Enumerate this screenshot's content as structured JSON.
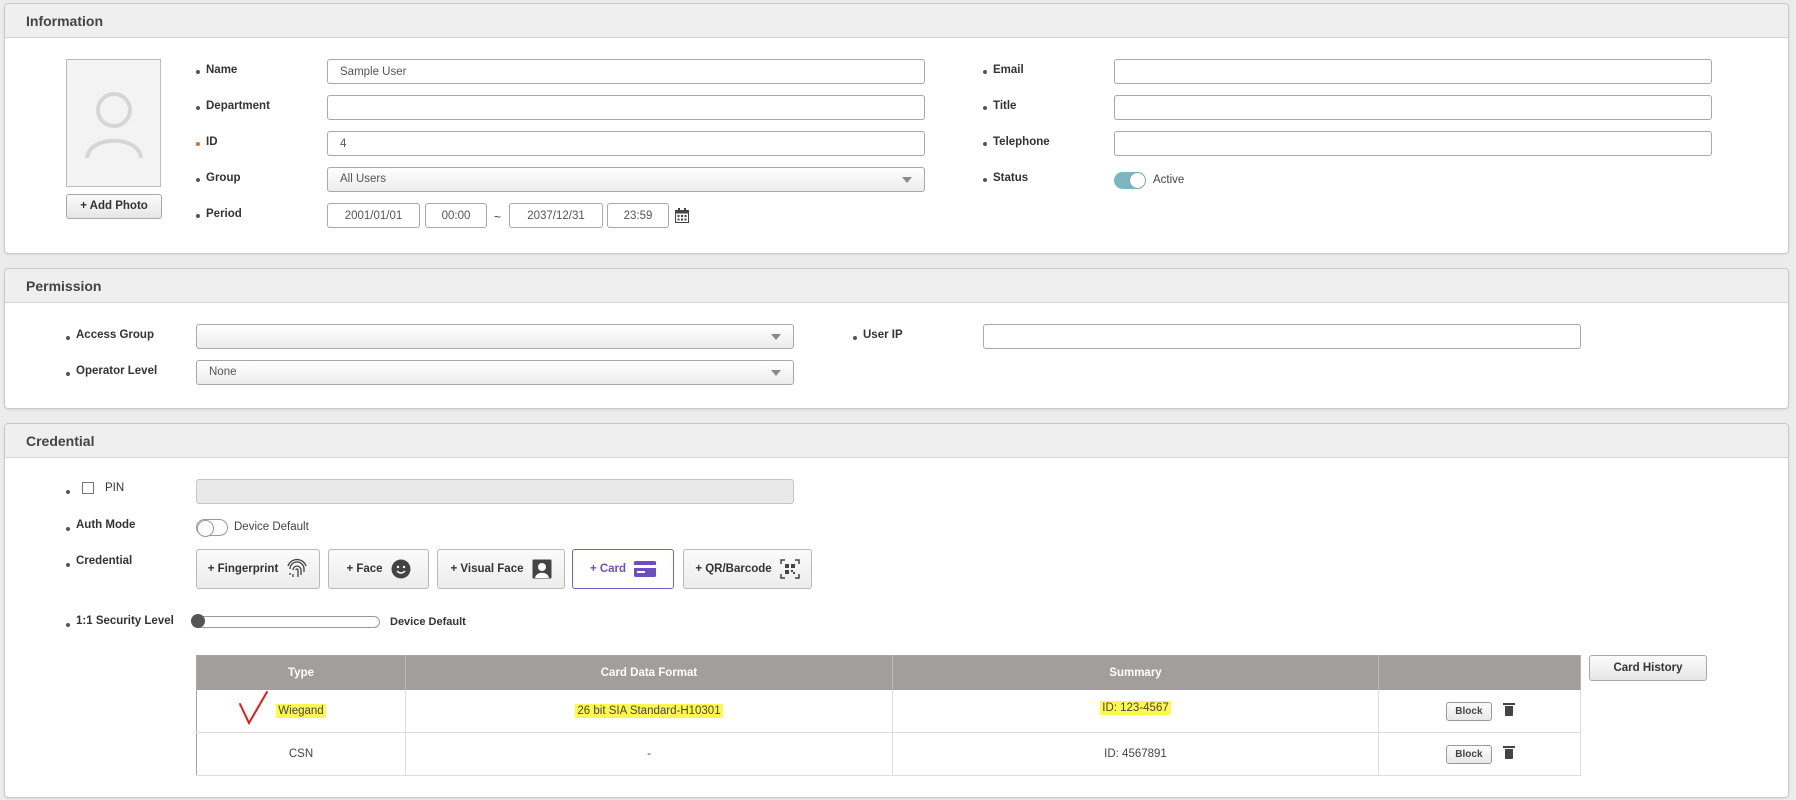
{
  "information": {
    "title": "Information",
    "add_photo": "+ Add Photo",
    "name_label": "Name",
    "name_value": "Sample User",
    "department_label": "Department",
    "department_value": "",
    "id_label": "ID",
    "id_value": "4",
    "group_label": "Group",
    "group_value": "All Users",
    "period_label": "Period",
    "period_start_date": "2001/01/01",
    "period_start_time": "00:00",
    "period_sep": "~",
    "period_end_date": "2037/12/31",
    "period_end_time": "23:59",
    "email_label": "Email",
    "email_value": "",
    "title_label": "Title",
    "title_value": "",
    "telephone_label": "Telephone",
    "telephone_value": "",
    "status_label": "Status",
    "status_value": "Active"
  },
  "permission": {
    "title": "Permission",
    "access_group_label": "Access Group",
    "access_group_value": "",
    "operator_level_label": "Operator Level",
    "operator_level_value": "None",
    "user_ip_label": "User IP",
    "user_ip_value": ""
  },
  "credential": {
    "title": "Credential",
    "pin_label": "PIN",
    "auth_mode_label": "Auth Mode",
    "auth_mode_value": "Device Default",
    "credential_label": "Credential",
    "buttons": {
      "fingerprint": "+ Fingerprint",
      "face": "+ Face",
      "visual_face": "+ Visual Face",
      "card": "+ Card",
      "qr": "+ QR/Barcode"
    },
    "security_level_label": "1:1 Security Level",
    "security_level_value": "Device Default",
    "card_history": "Card History",
    "table": {
      "headers": [
        "Type",
        "Card Data Format",
        "Summary",
        ""
      ],
      "rows": [
        {
          "type": "Wiegand",
          "format": "26 bit SIA Standard-H10301",
          "summary": "ID: 123-4567",
          "action": "Block"
        },
        {
          "type": "CSN",
          "format": "-",
          "summary": "ID: 4567891",
          "action": "Block"
        }
      ]
    }
  },
  "colors": {
    "accent": "#6d4fc0",
    "toggle_on": "#7fb5c3",
    "highlight": "#fff94d",
    "table_header": "#a29e9e"
  }
}
